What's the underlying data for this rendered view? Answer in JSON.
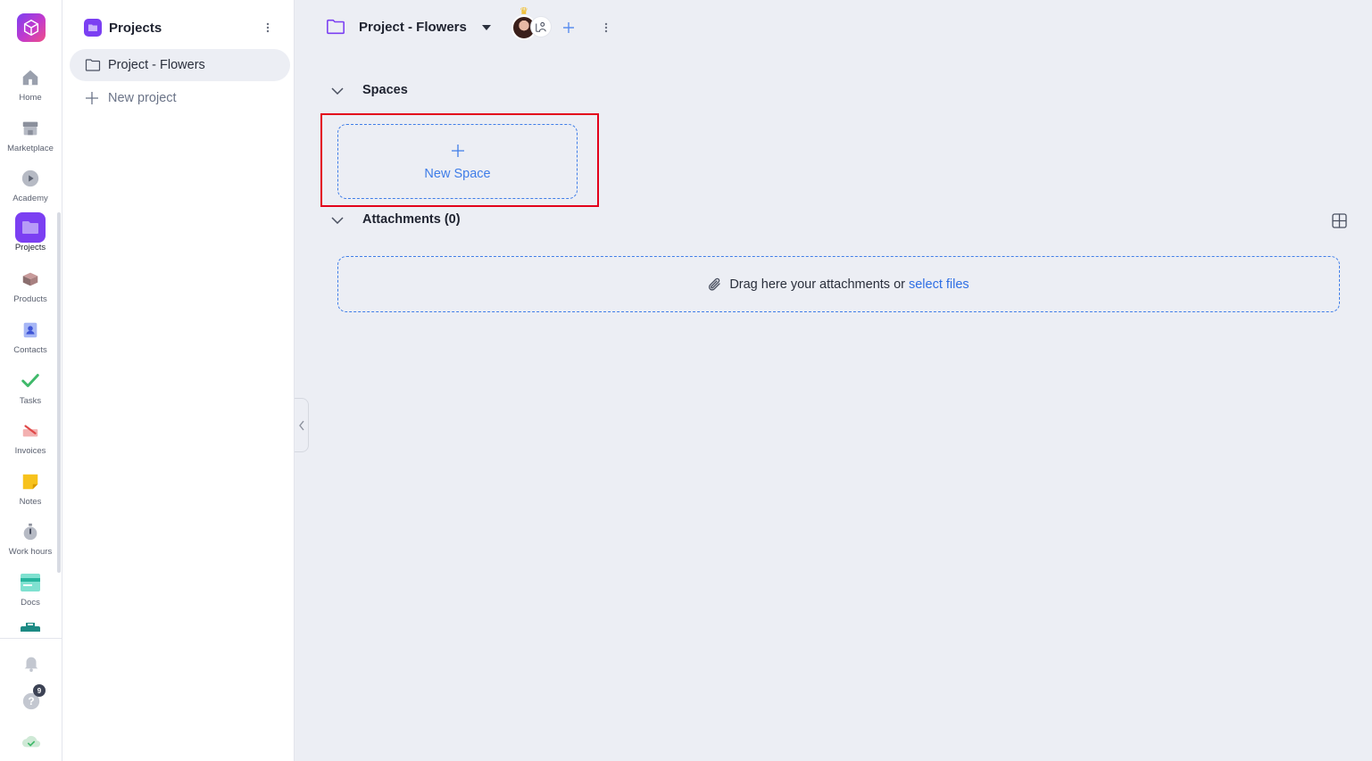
{
  "rail": {
    "logo": "app-logo",
    "items": [
      {
        "label": "Home",
        "icon": "home-icon"
      },
      {
        "label": "Marketplace",
        "icon": "store-icon"
      },
      {
        "label": "Academy",
        "icon": "play-icon"
      },
      {
        "label": "Projects",
        "icon": "folder-icon",
        "active": true
      },
      {
        "label": "Products",
        "icon": "box-icon"
      },
      {
        "label": "Contacts",
        "icon": "contact-icon"
      },
      {
        "label": "Tasks",
        "icon": "check-icon"
      },
      {
        "label": "Invoices",
        "icon": "invoice-icon"
      },
      {
        "label": "Notes",
        "icon": "note-icon"
      },
      {
        "label": "Work hours",
        "icon": "stopwatch-icon"
      },
      {
        "label": "Docs",
        "icon": "docs-icon"
      }
    ],
    "help_badge": "9"
  },
  "sidebar": {
    "title": "Projects",
    "projects": [
      {
        "label": "Project - Flowers"
      }
    ],
    "new_project_label": "New project"
  },
  "main": {
    "project_title": "Project - Flowers",
    "spaces_title": "Spaces",
    "new_space_label": "New Space",
    "attachments_title": "Attachments (0)",
    "dropzone_text": "Drag here your attachments or",
    "dropzone_link": "select files"
  },
  "colors": {
    "accent": "#7b3ff2",
    "link": "#2f6fe4",
    "highlight": "#e3001b",
    "background": "#eceef4"
  }
}
